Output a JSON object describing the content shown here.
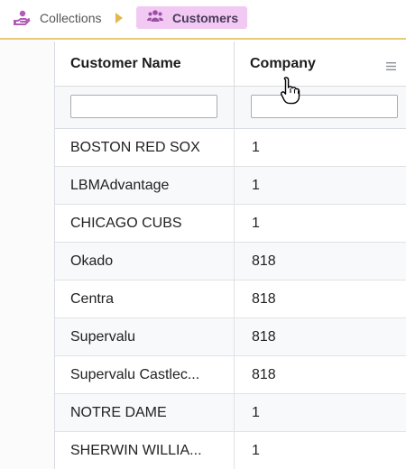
{
  "breadcrumb": {
    "items": [
      {
        "label": "Collections",
        "icon": "hand-money-icon"
      },
      {
        "label": "Customers",
        "icon": "users-icon",
        "active": true
      }
    ],
    "separator_icon": "triangle-right-icon",
    "active_bg": "#f2c9f2"
  },
  "grid": {
    "columns": [
      {
        "label": "Customer Name"
      },
      {
        "label": "Company",
        "menu_icon": "menu-lines-icon"
      }
    ],
    "filters": [
      "",
      ""
    ],
    "rows": [
      {
        "name": "BOSTON RED SOX",
        "company": "1"
      },
      {
        "name": "LBMAdvantage",
        "company": "1"
      },
      {
        "name": "CHICAGO CUBS",
        "company": "1"
      },
      {
        "name": "Okado",
        "company": "818"
      },
      {
        "name": "Centra",
        "company": "818"
      },
      {
        "name": "Supervalu",
        "company": "818"
      },
      {
        "name": "Supervalu Castlec...",
        "company": "818"
      },
      {
        "name": "NOTRE DAME",
        "company": "1"
      },
      {
        "name": "SHERWIN WILLIA...",
        "company": "1"
      }
    ]
  },
  "colors": {
    "accent_line": "#e6c979",
    "icon_purple": "#9b4fa6"
  }
}
